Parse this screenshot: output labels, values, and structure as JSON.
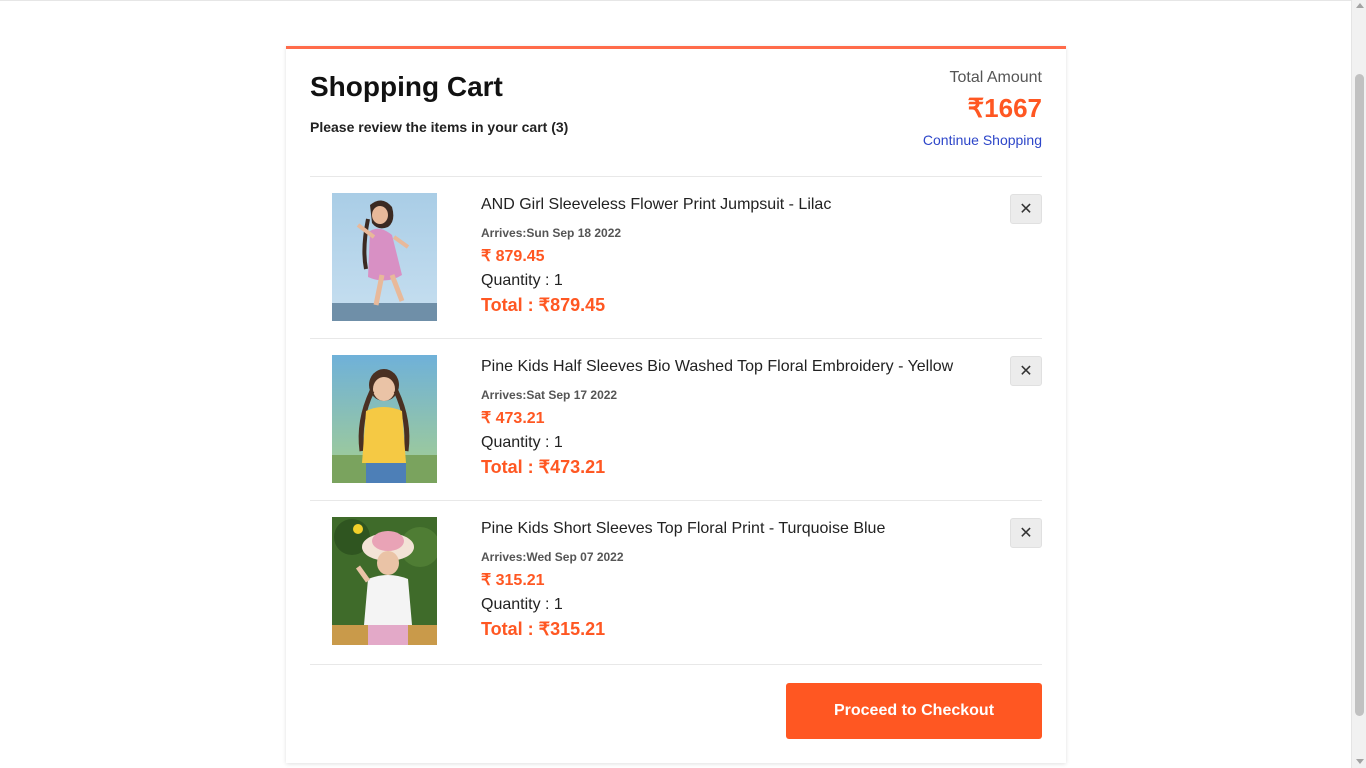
{
  "cart": {
    "title": "Shopping Cart",
    "subtitle": "Please review the items in your cart (3)",
    "total_label": "Total Amount",
    "total_amount": "₹1667",
    "continue_label": "Continue Shopping",
    "checkout_label": "Proceed to Checkout",
    "remove_glyph": "✕",
    "items": [
      {
        "name": "AND Girl Sleeveless Flower Print Jumpsuit - Lilac",
        "arrives": "Arrives:Sun Sep 18 2022",
        "price": "₹ 879.45",
        "quantity": "Quantity : 1",
        "total": "Total : ₹879.45"
      },
      {
        "name": "Pine Kids Half Sleeves Bio Washed Top Floral Embroidery - Yellow",
        "arrives": "Arrives:Sat Sep 17 2022",
        "price": "₹ 473.21",
        "quantity": "Quantity : 1",
        "total": "Total : ₹473.21"
      },
      {
        "name": "Pine Kids Short Sleeves Top Floral Print - Turquoise Blue",
        "arrives": "Arrives:Wed Sep 07 2022",
        "price": "₹ 315.21",
        "quantity": "Quantity : 1",
        "total": "Total : ₹315.21"
      }
    ]
  },
  "colors": {
    "accent": "#ff5722",
    "border_top": "#ff6b4a",
    "link": "#2d46c9"
  }
}
